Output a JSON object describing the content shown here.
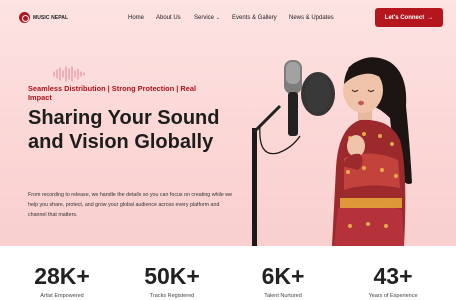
{
  "brand": {
    "name": "MUSIC NEPAL",
    "color": "#b5151d"
  },
  "nav": {
    "items": [
      {
        "label": "Home"
      },
      {
        "label": "About Us"
      },
      {
        "label": "Service"
      },
      {
        "label": "Events & Gallery"
      },
      {
        "label": "News & Updates"
      }
    ],
    "service_chevron": "chevron-down-icon"
  },
  "cta": {
    "label": "Let's Connect",
    "icon": "arrow-right-icon"
  },
  "hero": {
    "tagline": "Seamless Distribution | Strong Protection | Real Impact",
    "headline": "Sharing Your Sound and Vision Globally",
    "description": "From recording to release, we handle the details so you can focus on creating while we help you share, protect, and grow your global audience across every platform and channel that matters."
  },
  "stats": [
    {
      "value": "28K+",
      "label": "Artist Empowered"
    },
    {
      "value": "50K+",
      "label": "Tracks Registered"
    },
    {
      "value": "6K+",
      "label": "Talent Nurtured"
    },
    {
      "value": "43+",
      "label": "Years of Experience"
    }
  ]
}
